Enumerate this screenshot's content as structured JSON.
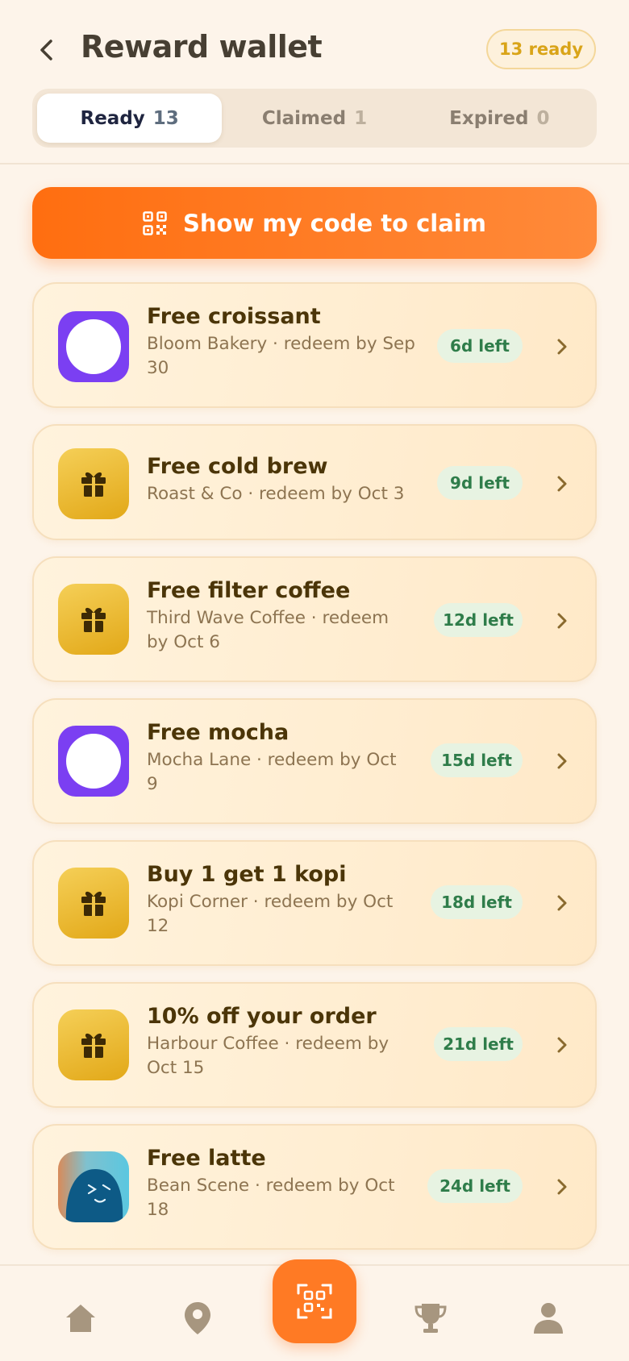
{
  "header": {
    "title": "Reward wallet",
    "ready_badge": "13 ready",
    "back_icon": "chevron-left-icon"
  },
  "tabs": [
    {
      "label": "Ready",
      "count": "13",
      "active": true
    },
    {
      "label": "Claimed",
      "count": "1",
      "active": false
    },
    {
      "label": "Expired",
      "count": "0",
      "active": false
    }
  ],
  "claim_button": {
    "label": "Show my code to claim",
    "icon": "qr-code-icon"
  },
  "rewards": [
    {
      "title": "Free croissant",
      "subtitle": "Bloom Bakery · redeem by Sep 30",
      "days_left": "6d left",
      "thumb": "purple-disc"
    },
    {
      "title": "Free cold brew",
      "subtitle": "Roast & Co · redeem by Oct 3",
      "days_left": "9d left",
      "thumb": "gift-icon"
    },
    {
      "title": "Free filter coffee",
      "subtitle": "Third Wave Coffee · redeem by Oct 6",
      "days_left": "12d left",
      "thumb": "gift-icon"
    },
    {
      "title": "Free mocha",
      "subtitle": "Mocha Lane · redeem by Oct 9",
      "days_left": "15d left",
      "thumb": "purple-disc"
    },
    {
      "title": "Buy 1 get 1 kopi",
      "subtitle": "Kopi Corner · redeem by Oct 12",
      "days_left": "18d left",
      "thumb": "gift-icon"
    },
    {
      "title": "10% off your order",
      "subtitle": "Harbour Coffee · redeem by Oct 15",
      "days_left": "21d left",
      "thumb": "gift-icon"
    },
    {
      "title": "Free latte",
      "subtitle": "Bean Scene · redeem by Oct 18",
      "days_left": "24d left",
      "thumb": "avatar"
    }
  ],
  "nav": [
    "home-icon",
    "location-pin-icon",
    "scan-qr-icon",
    "trophy-icon",
    "profile-icon"
  ],
  "colors": {
    "accent": "#ff7a24",
    "background": "#fdf4ea",
    "card": "#ffeed3",
    "pill_bg": "#e7f3e2",
    "pill_text": "#2f7d4a",
    "badge_text": "#d9a418"
  }
}
